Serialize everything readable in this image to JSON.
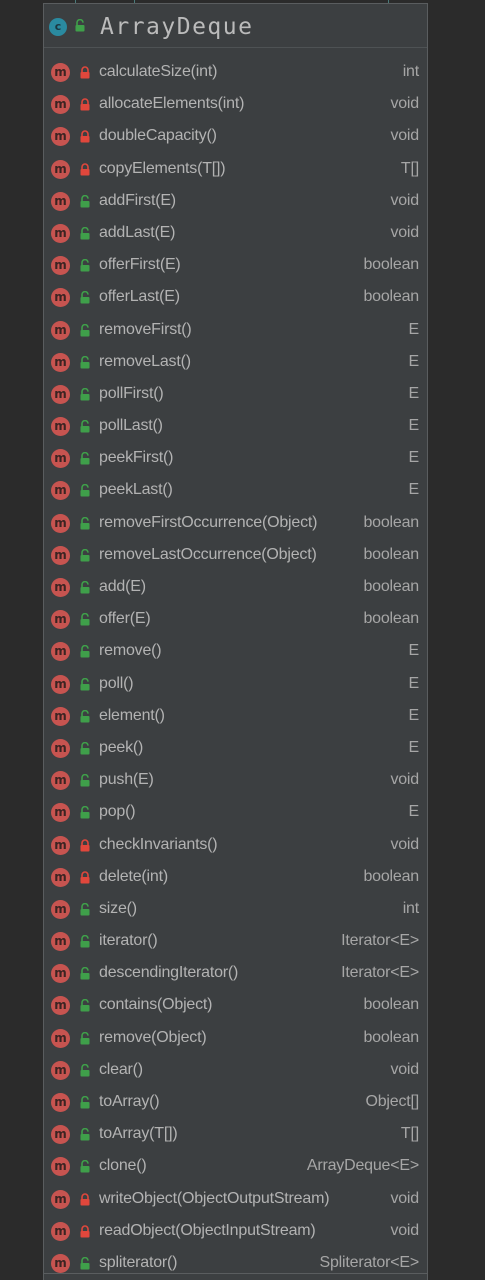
{
  "class": {
    "icon_letter": "c",
    "name": "ArrayDeque",
    "visibility_icon": "green-unlocked-icon"
  },
  "colors": {
    "background": "#2b2b2b",
    "panel": "#3c3f41",
    "method_icon": "#c75450",
    "class_icon": "#2a8aa0",
    "private_lock": "#e0473c",
    "public_lock": "#3f9f4a",
    "text": "#b3b3b3"
  },
  "members": [
    {
      "name": "calculateSize(int)",
      "type": "int",
      "visibility": "private"
    },
    {
      "name": "allocateElements(int)",
      "type": "void",
      "visibility": "private"
    },
    {
      "name": "doubleCapacity()",
      "type": "void",
      "visibility": "private"
    },
    {
      "name": "copyElements(T[])",
      "type": "T[]",
      "visibility": "private"
    },
    {
      "name": "addFirst(E)",
      "type": "void",
      "visibility": "public"
    },
    {
      "name": "addLast(E)",
      "type": "void",
      "visibility": "public"
    },
    {
      "name": "offerFirst(E)",
      "type": "boolean",
      "visibility": "public"
    },
    {
      "name": "offerLast(E)",
      "type": "boolean",
      "visibility": "public"
    },
    {
      "name": "removeFirst()",
      "type": "E",
      "visibility": "public"
    },
    {
      "name": "removeLast()",
      "type": "E",
      "visibility": "public"
    },
    {
      "name": "pollFirst()",
      "type": "E",
      "visibility": "public"
    },
    {
      "name": "pollLast()",
      "type": "E",
      "visibility": "public"
    },
    {
      "name": "peekFirst()",
      "type": "E",
      "visibility": "public"
    },
    {
      "name": "peekLast()",
      "type": "E",
      "visibility": "public"
    },
    {
      "name": "removeFirstOccurrence(Object)",
      "type": "boolean",
      "visibility": "public"
    },
    {
      "name": "removeLastOccurrence(Object)",
      "type": "boolean",
      "visibility": "public"
    },
    {
      "name": "add(E)",
      "type": "boolean",
      "visibility": "public"
    },
    {
      "name": "offer(E)",
      "type": "boolean",
      "visibility": "public"
    },
    {
      "name": "remove()",
      "type": "E",
      "visibility": "public"
    },
    {
      "name": "poll()",
      "type": "E",
      "visibility": "public"
    },
    {
      "name": "element()",
      "type": "E",
      "visibility": "public"
    },
    {
      "name": "peek()",
      "type": "E",
      "visibility": "public"
    },
    {
      "name": "push(E)",
      "type": "void",
      "visibility": "public"
    },
    {
      "name": "pop()",
      "type": "E",
      "visibility": "public"
    },
    {
      "name": "checkInvariants()",
      "type": "void",
      "visibility": "private"
    },
    {
      "name": "delete(int)",
      "type": "boolean",
      "visibility": "private"
    },
    {
      "name": "size()",
      "type": "int",
      "visibility": "public"
    },
    {
      "name": "iterator()",
      "type": "Iterator<E>",
      "visibility": "public"
    },
    {
      "name": "descendingIterator()",
      "type": "Iterator<E>",
      "visibility": "public"
    },
    {
      "name": "contains(Object)",
      "type": "boolean",
      "visibility": "public"
    },
    {
      "name": "remove(Object)",
      "type": "boolean",
      "visibility": "public"
    },
    {
      "name": "clear()",
      "type": "void",
      "visibility": "public"
    },
    {
      "name": "toArray()",
      "type": "Object[]",
      "visibility": "public"
    },
    {
      "name": "toArray(T[])",
      "type": "T[]",
      "visibility": "public"
    },
    {
      "name": "clone()",
      "type": "ArrayDeque<E>",
      "visibility": "public"
    },
    {
      "name": "writeObject(ObjectOutputStream)",
      "type": "void",
      "visibility": "private"
    },
    {
      "name": "readObject(ObjectInputStream)",
      "type": "void",
      "visibility": "private"
    },
    {
      "name": "spliterator()",
      "type": "Spliterator<E>",
      "visibility": "public"
    }
  ]
}
